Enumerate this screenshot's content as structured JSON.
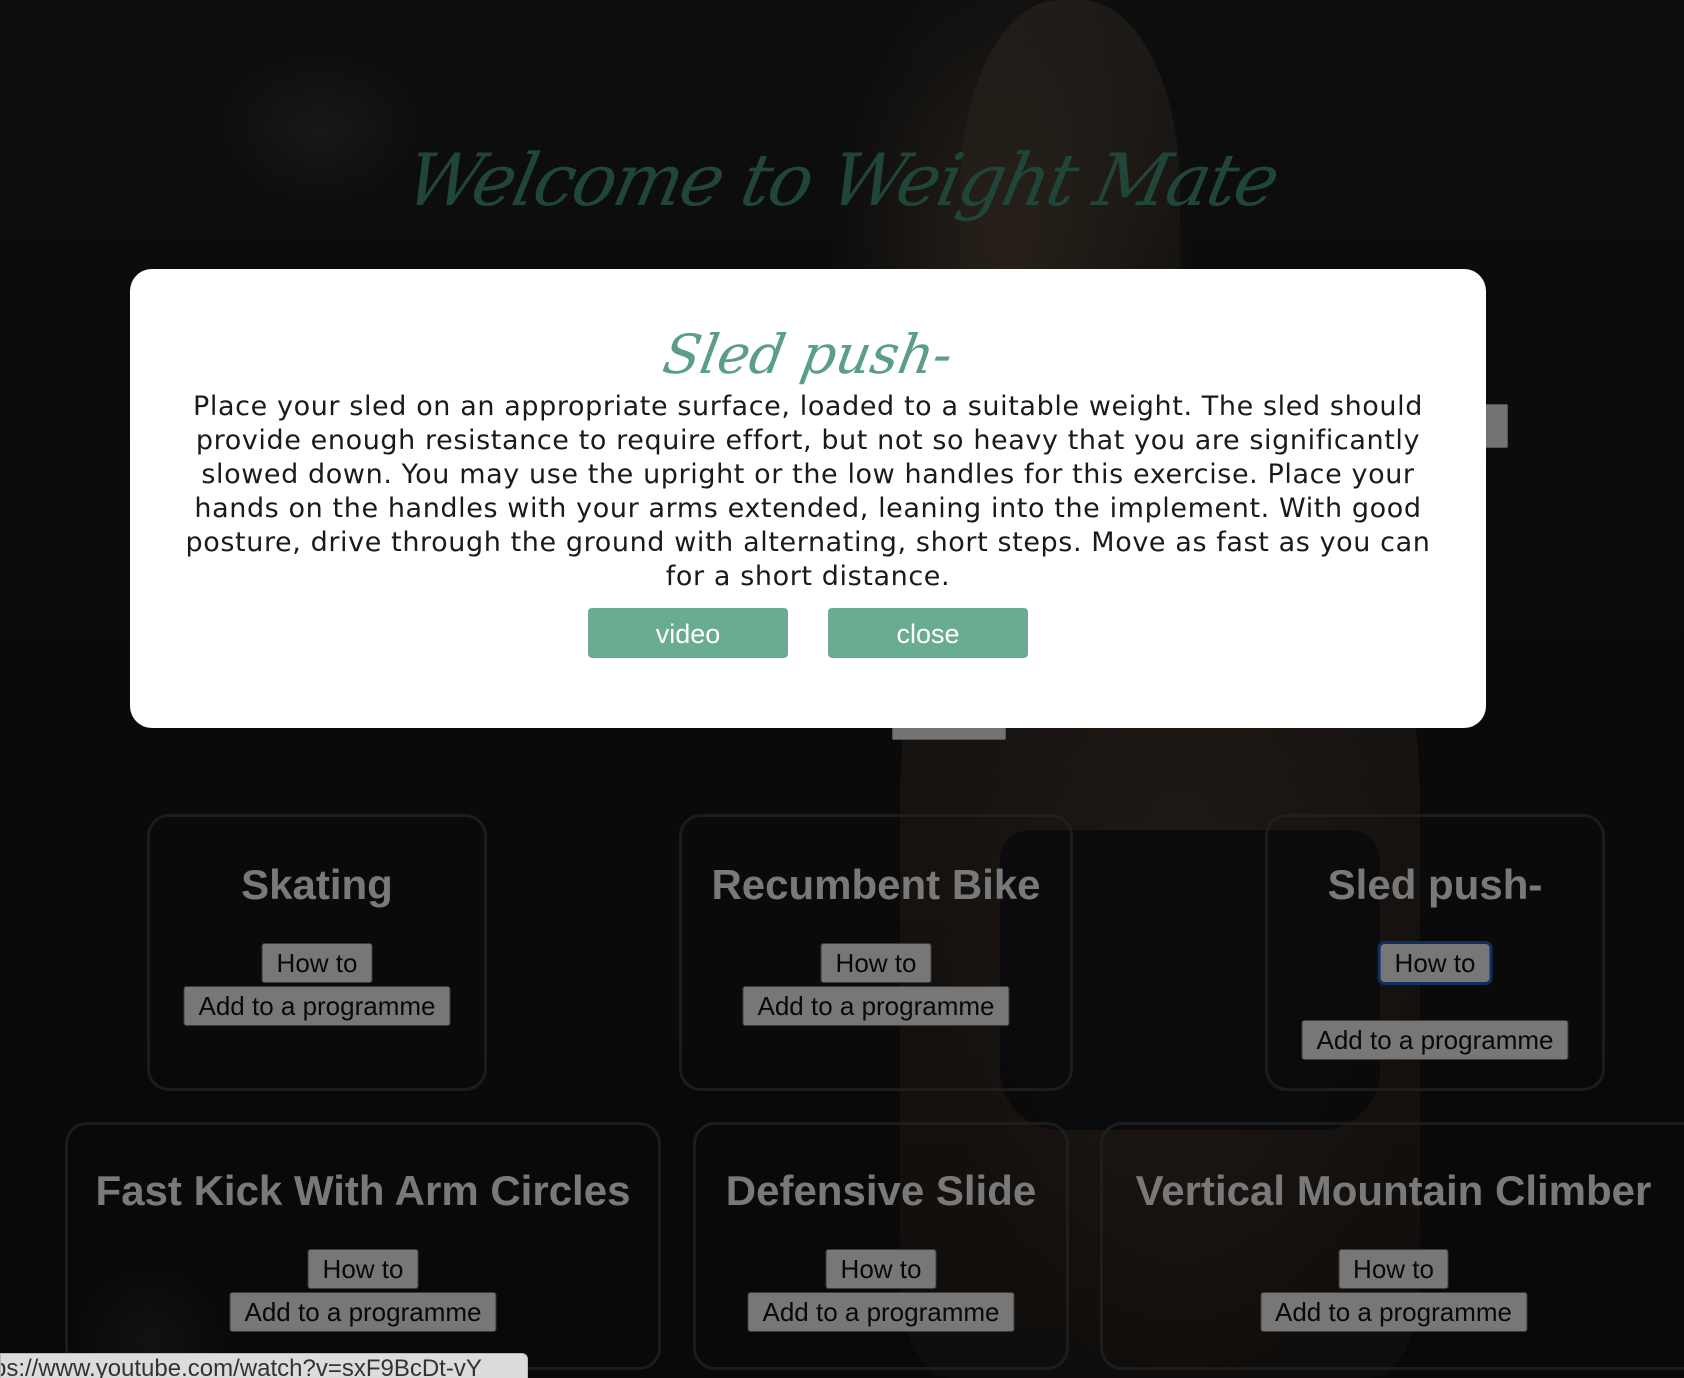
{
  "page": {
    "heading": "Welcome to Weight Mate"
  },
  "cards_row1": [
    {
      "title": "Skating",
      "how_to": "How to",
      "add": "Add to a programme"
    },
    {
      "title": "Recumbent Bike",
      "how_to": "How to",
      "add": "Add to a programme"
    },
    {
      "title": "Sled push-",
      "how_to": "How to",
      "add": "Add to a programme"
    }
  ],
  "cards_row2": [
    {
      "title": "Fast Kick With Arm Circles",
      "how_to": "How to",
      "add": "Add to a programme"
    },
    {
      "title": "Defensive Slide",
      "how_to": "How to",
      "add": "Add to a programme"
    },
    {
      "title": "Vertical Mountain Climber",
      "how_to": "How to",
      "add": "Add to a programme"
    }
  ],
  "modal": {
    "title": "Sled push-",
    "description": "Place your sled on an appropriate surface, loaded to a suitable weight. The sled should provide enough resistance to require effort, but not so heavy that you are significantly slowed down. You may use the upright or the low handles for this exercise. Place your hands on the handles with your arms extended, leaning into the implement. With good posture, drive through the ground with alternating, short steps. Move as fast as you can for a short distance.",
    "video_label": "video",
    "close_label": "close"
  },
  "status_bar": {
    "url": "ps://www.youtube.com/watch?v=sxF9BcDt-vY"
  },
  "colors": {
    "accent": "#6aac90",
    "title_green": "#3f8d71",
    "focus_ring": "#1f5fc4"
  }
}
